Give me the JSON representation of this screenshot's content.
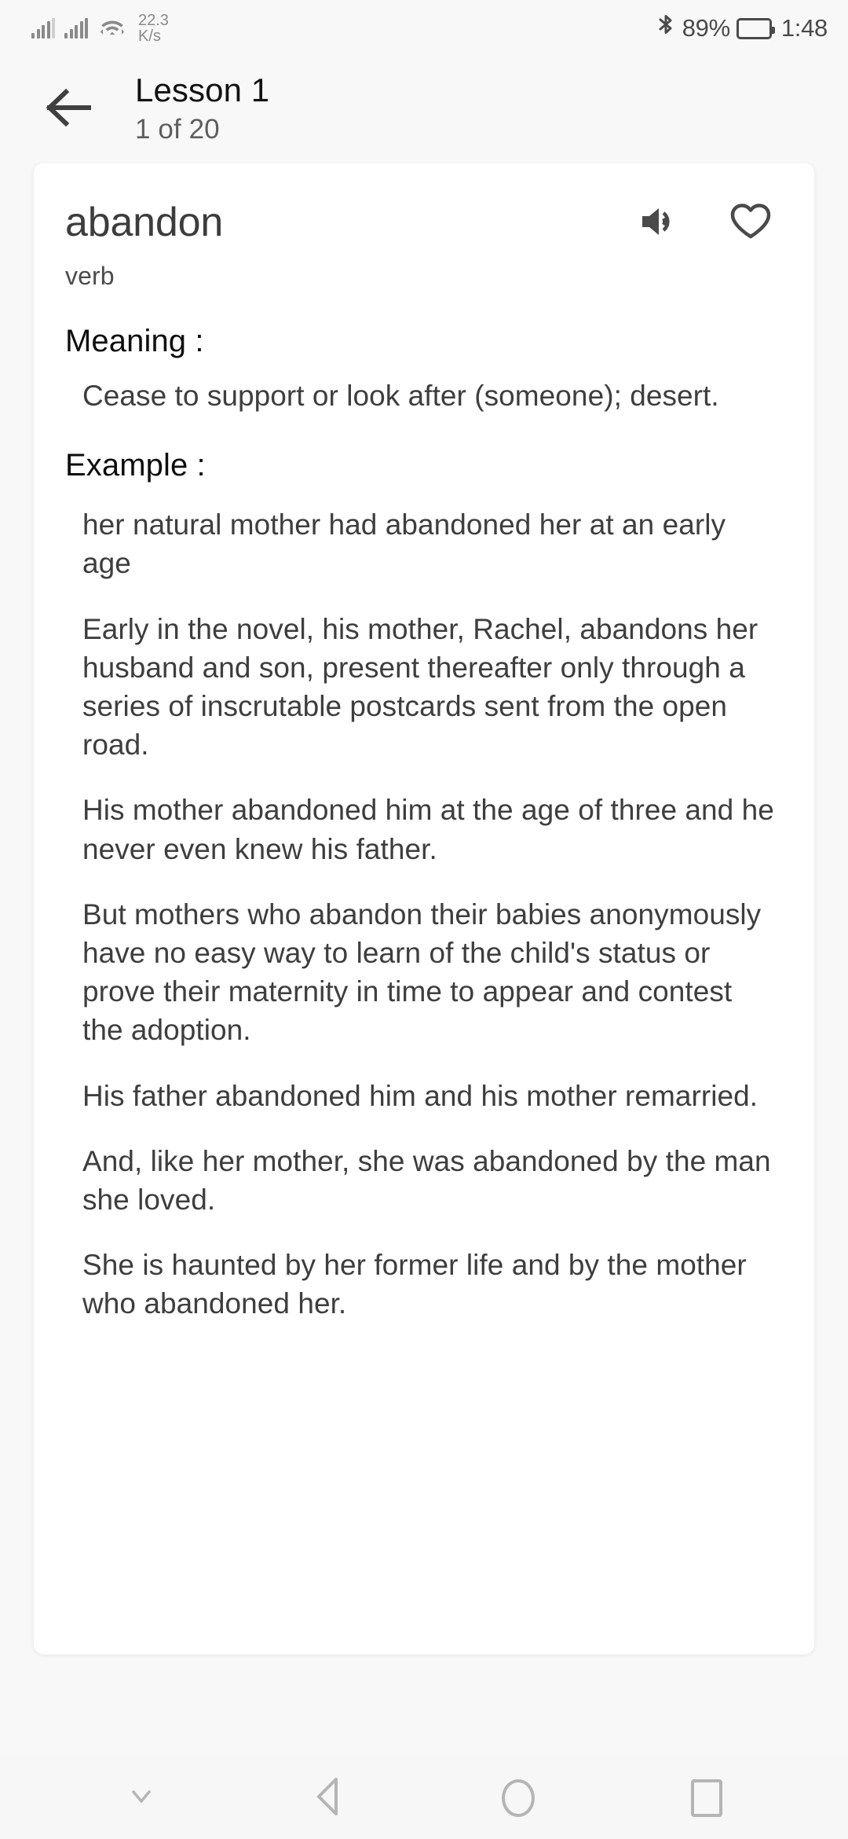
{
  "status_bar": {
    "network_rate": "22.3",
    "network_unit": "K/s",
    "battery_percent": "89%",
    "battery_level": 89,
    "clock": "1:48",
    "icons": [
      "signal-bars-icon",
      "signal-bars-icon",
      "wifi-icon",
      "bluetooth-icon",
      "battery-icon"
    ]
  },
  "header": {
    "back_icon": "arrow-left-icon",
    "title": "Lesson 1",
    "subtitle": "1 of 20"
  },
  "card": {
    "word": "abandon",
    "part_of_speech": "verb",
    "speak_icon": "volume-up-icon",
    "favorite_icon": "heart-outline-icon",
    "meaning_heading": "Meaning :",
    "meaning_text": "Cease to support or look after (someone); desert.",
    "example_heading": "Example :",
    "examples": [
      "her natural mother had abandoned her at an early age",
      "Early in the novel, his mother, Rachel, abandons her husband and son, present thereafter only through a series of inscrutable postcards sent from the open road.",
      "His mother abandoned him at the age of three and he never even knew his father.",
      "But mothers who abandon their babies anonymously have no easy way to learn of the child's status or prove their maternity in time to appear and contest the adoption.",
      "His father abandoned him and his mother remarried.",
      "And, like her mother, she was abandoned by the man she loved.",
      "She is haunted by her former life and by the mother who abandoned her."
    ]
  },
  "nav_bar": {
    "items": [
      {
        "name": "chevron-down-icon"
      },
      {
        "name": "back-triangle-icon"
      },
      {
        "name": "home-circle-icon"
      },
      {
        "name": "recents-square-icon"
      }
    ]
  },
  "colors": {
    "page_background": "#f8f8f8",
    "card_background": "#ffffff",
    "primary_text": "#121212",
    "secondary_text": "#5e5e5e",
    "body_text": "#3e3e3e",
    "icon_gray": "#4a4a4a",
    "nav_icon_gray": "#b5b5b5"
  }
}
